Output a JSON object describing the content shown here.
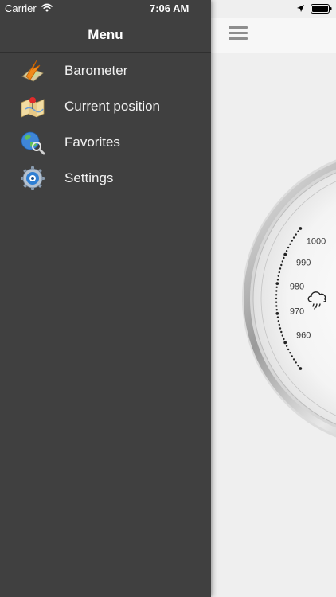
{
  "status_bar": {
    "carrier": "Carrier",
    "time": "7:06 AM",
    "icons": [
      "wifi-icon",
      "location-arrow-icon",
      "battery-icon"
    ]
  },
  "drawer": {
    "title": "Menu",
    "items": [
      {
        "label": "Barometer",
        "icon": "barometer-icon"
      },
      {
        "label": "Current position",
        "icon": "map-pin-icon"
      },
      {
        "label": "Favorites",
        "icon": "globe-search-icon"
      },
      {
        "label": "Settings",
        "icon": "gear-icon"
      }
    ]
  },
  "main": {
    "menu_icon": "hamburger-icon",
    "gauge": {
      "scale_labels": [
        "1000",
        "990",
        "980",
        "970",
        "960"
      ],
      "weather_icon": "rain-cloud-icon"
    }
  },
  "colors": {
    "drawer_bg": "#404040",
    "drawer_text": "#f2f2f2",
    "main_bg": "#efefef",
    "header_bg": "#f7f7f7"
  }
}
